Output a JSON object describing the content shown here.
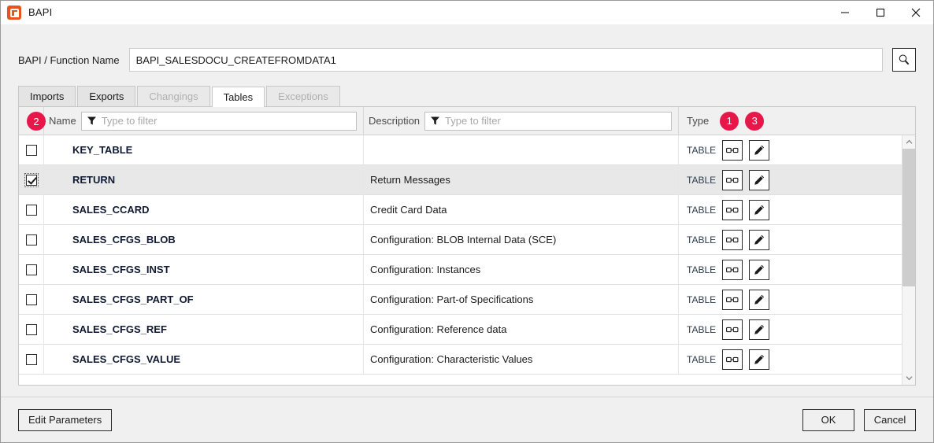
{
  "window": {
    "title": "BAPI",
    "app_icon": "bapi-app-icon",
    "accent_color": "#E8174A",
    "controls": {
      "minimize": "minimize-icon",
      "maximize": "maximize-icon",
      "close": "close-icon"
    }
  },
  "form": {
    "label": "BAPI / Function Name",
    "value": "BAPI_SALESDOCU_CREATEFROMDATA1",
    "placeholder": "",
    "search_icon": "search-icon"
  },
  "tabs": [
    {
      "label": "Imports",
      "active": false,
      "disabled": false
    },
    {
      "label": "Exports",
      "active": false,
      "disabled": false
    },
    {
      "label": "Changings",
      "active": false,
      "disabled": true
    },
    {
      "label": "Tables",
      "active": true,
      "disabled": false
    },
    {
      "label": "Exceptions",
      "active": false,
      "disabled": true
    }
  ],
  "grid": {
    "headers": {
      "name": "Name",
      "description": "Description",
      "type": "Type"
    },
    "filters": {
      "name_placeholder": "Type to filter",
      "name_value": "",
      "description_placeholder": "Type to filter",
      "description_value": "",
      "filter_icon": "funnel-icon"
    },
    "badges": {
      "type_column": "1",
      "name_column": "2",
      "edit_column": "3"
    },
    "icons": {
      "view": "glasses-icon",
      "edit": "pencil-icon"
    },
    "rows": [
      {
        "checked": false,
        "focused": false,
        "selected": false,
        "name": "KEY_TABLE",
        "description": "",
        "type": "TABLE"
      },
      {
        "checked": true,
        "focused": true,
        "selected": true,
        "name": "RETURN",
        "description": "Return Messages",
        "type": "TABLE"
      },
      {
        "checked": false,
        "focused": false,
        "selected": false,
        "name": "SALES_CCARD",
        "description": "Credit Card Data",
        "type": "TABLE"
      },
      {
        "checked": false,
        "focused": false,
        "selected": false,
        "name": "SALES_CFGS_BLOB",
        "description": "Configuration: BLOB Internal Data (SCE)",
        "type": "TABLE"
      },
      {
        "checked": false,
        "focused": false,
        "selected": false,
        "name": "SALES_CFGS_INST",
        "description": "Configuration: Instances",
        "type": "TABLE"
      },
      {
        "checked": false,
        "focused": false,
        "selected": false,
        "name": "SALES_CFGS_PART_OF",
        "description": "Configuration: Part-of Specifications",
        "type": "TABLE"
      },
      {
        "checked": false,
        "focused": false,
        "selected": false,
        "name": "SALES_CFGS_REF",
        "description": "Configuration: Reference data",
        "type": "TABLE"
      },
      {
        "checked": false,
        "focused": false,
        "selected": false,
        "name": "SALES_CFGS_VALUE",
        "description": "Configuration: Characteristic Values",
        "type": "TABLE"
      }
    ],
    "scrollbar": {
      "up_arrow": "chevron-up-icon",
      "down_arrow": "chevron-down-icon"
    }
  },
  "footer": {
    "edit_parameters": "Edit Parameters",
    "ok": "OK",
    "cancel": "Cancel"
  }
}
